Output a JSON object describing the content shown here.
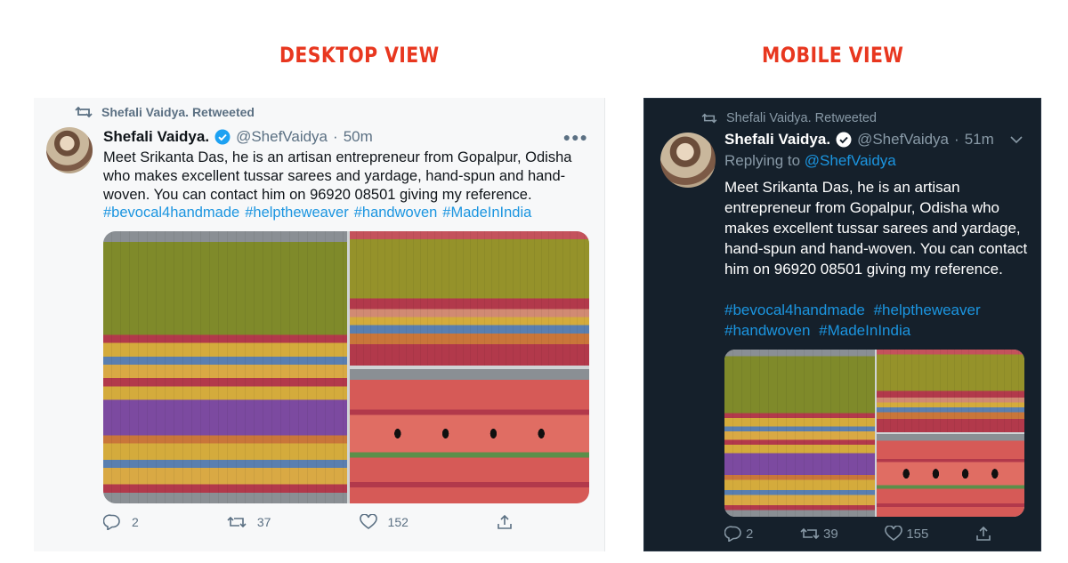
{
  "headings": {
    "desktop": "DESKTOP VIEW",
    "mobile": "MOBILE VIEW"
  },
  "tweet": {
    "retweeted_by": "Shefali Vaidya. Retweeted",
    "name": "Shefali Vaidya.",
    "handle": "@ShefVaidya",
    "separator": "·",
    "replying_label": "Replying to",
    "replying_to": "@ShefVaidya",
    "body": "Meet Srikanta Das, he is an artisan entrepreneur from Gopalpur, Odisha who makes excellent tussar sarees and yardage, hand-spun and hand-woven. You can contact him on 96920 08501 giving my reference.",
    "desktop_body_lines": [
      "Meet Srikanta Das, he is an artisan entrepreneur from Gopalpur, Odisha",
      "who makes excellent tussar sarees and yardage, hand-spun and hand-",
      "woven. You can contact him on 96920 08501 giving my reference."
    ],
    "hashtags": [
      "#bevocal4handmade",
      "#helptheweaver",
      "#handwoven",
      "#MadeInIndia"
    ]
  },
  "desktop": {
    "time": "50m",
    "more_icon": "more-horizontal-icon",
    "stats": {
      "replies": "2",
      "retweets": "37",
      "likes": "152"
    }
  },
  "mobile": {
    "time": "51m",
    "stats": {
      "replies": "2",
      "retweets": "39",
      "likes": "155"
    }
  },
  "colors": {
    "heading": "#e8371f",
    "link": "#1b95e0",
    "dark_bg": "#15202b",
    "light_bg": "#f7f8f9",
    "verified": "#1da1f2"
  }
}
